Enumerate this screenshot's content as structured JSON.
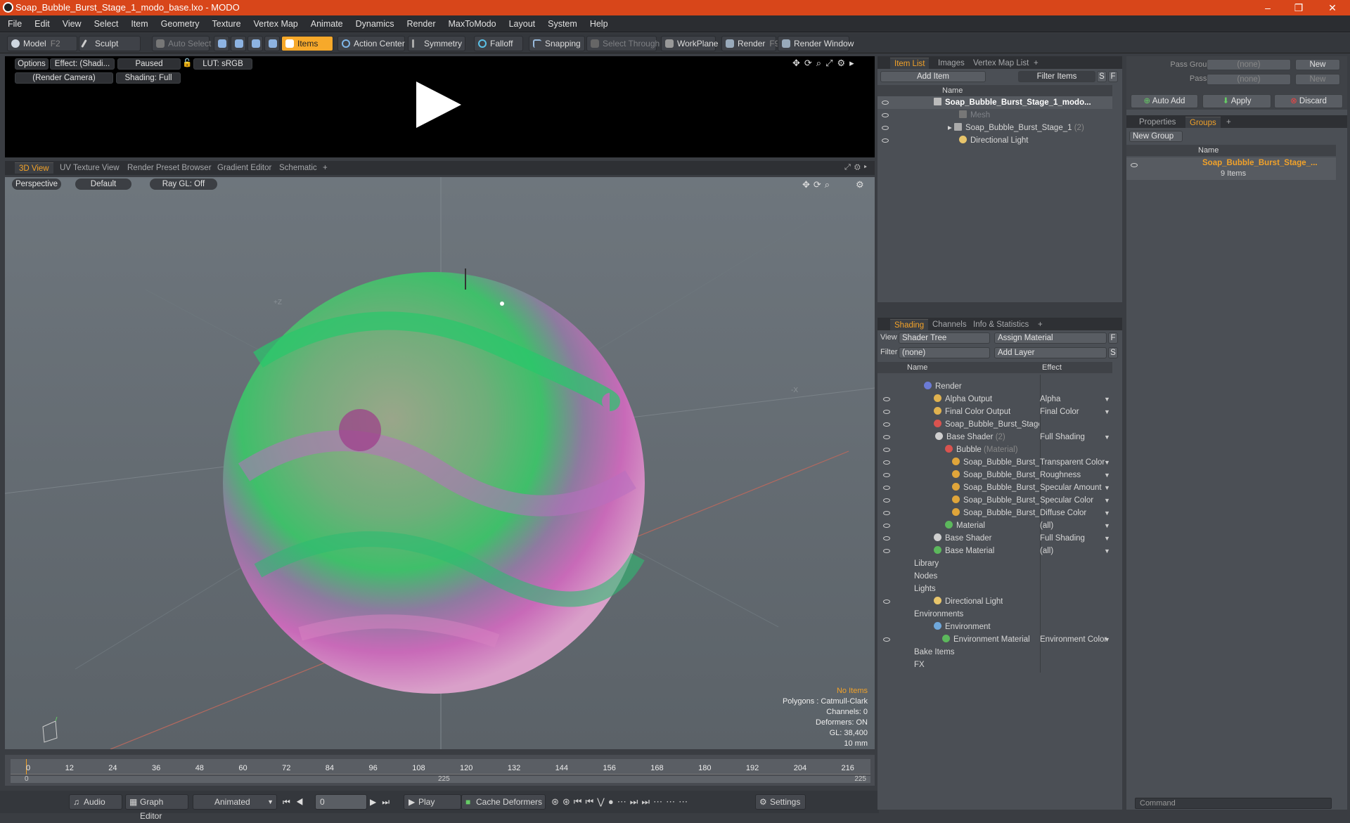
{
  "window": {
    "title": "Soap_Bubble_Burst_Stage_1_modo_base.lxo - MODO",
    "minimize": "–",
    "maximize": "❐",
    "close": "✕"
  },
  "menu": [
    "File",
    "Edit",
    "View",
    "Select",
    "Item",
    "Geometry",
    "Texture",
    "Vertex Map",
    "Animate",
    "Dynamics",
    "Render",
    "MaxToModo",
    "Layout",
    "System",
    "Help"
  ],
  "toolbar": {
    "model": "Model",
    "model_key": "F2",
    "sculpt": "Sculpt",
    "auto_select": "Auto Select",
    "items": "Items",
    "action_center": "Action Center",
    "symmetry": "Symmetry",
    "falloff": "Falloff",
    "snapping": "Snapping",
    "select_through": "Select Through",
    "workplane": "WorkPlane",
    "render": "Render",
    "render_key": "F9",
    "render_window": "Render Window"
  },
  "render_preview": {
    "options": "Options",
    "effect": "Effect: (Shadi...",
    "paused": "Paused",
    "lut": "LUT: sRGB",
    "camera": "(Render Camera)",
    "shading": "Shading: Full"
  },
  "viewport_tabs": [
    "3D View",
    "UV Texture View",
    "Render Preset Browser",
    "Gradient Editor",
    "Schematic",
    "+"
  ],
  "viewport": {
    "projection": "Perspective",
    "style": "Default",
    "raygl": "Ray GL: Off",
    "info_no_items": "No Items",
    "info_lines": [
      "Polygons : Catmull-Clark",
      "Channels: 0",
      "Deformers: ON",
      "GL: 38,400",
      "10 mm"
    ],
    "axis_z": "+Z",
    "axis_x": "-X"
  },
  "timeline": {
    "ticks": [
      "0",
      "12",
      "24",
      "36",
      "48",
      "60",
      "72",
      "84",
      "96",
      "108",
      "120",
      "132",
      "144",
      "156",
      "168",
      "180",
      "192",
      "204",
      "216"
    ],
    "range_start": "0",
    "range_mid": "225",
    "range_end": "225"
  },
  "bottom": {
    "audio": "Audio",
    "graph_editor": "Graph Editor",
    "animated": "Animated",
    "frame": "0",
    "play": "Play",
    "cache_deformers": "Cache Deformers",
    "settings": "Settings"
  },
  "item_list": {
    "tabs": [
      "Item List",
      "Images",
      "Vertex Map List",
      "+"
    ],
    "add_item": "Add Item",
    "filter_items": "Filter Items",
    "s": "S",
    "f": "F",
    "col_name": "Name",
    "rows": [
      {
        "label": "Soap_Bubble_Burst_Stage_1_modo...",
        "count": ""
      },
      {
        "label": "Mesh",
        "count": ""
      },
      {
        "label": "Soap_Bubble_Burst_Stage_1",
        "count": "(2)"
      },
      {
        "label": "Directional Light",
        "count": ""
      }
    ]
  },
  "shading": {
    "tabs": [
      "Shading",
      "Channels",
      "Info & Statistics",
      "+"
    ],
    "view_label": "View",
    "view_value": "Shader Tree",
    "assign_material": "Assign Material",
    "f": "F",
    "filter_label": "Filter",
    "filter_value": "(none)",
    "add_layer": "Add Layer",
    "s": "S",
    "col_name": "Name",
    "col_effect": "Effect",
    "rows": [
      {
        "label": "Render",
        "sub": "",
        "effect": ""
      },
      {
        "label": "Alpha Output",
        "sub": "",
        "effect": "Alpha"
      },
      {
        "label": "Final Color Output",
        "sub": "",
        "effect": "Final Color"
      },
      {
        "label": "Soap_Bubble_Burst_Stage_...",
        "sub": "",
        "effect": ""
      },
      {
        "label": "Base Shader",
        "sub": "(2)",
        "effect": "Full Shading"
      },
      {
        "label": "Bubble",
        "sub": "(Material)",
        "effect": ""
      },
      {
        "label": "Soap_Bubble_Burst_St...",
        "sub": "",
        "effect": "Transparent Color"
      },
      {
        "label": "Soap_Bubble_Burst_St...",
        "sub": "",
        "effect": "Roughness"
      },
      {
        "label": "Soap_Bubble_Burst_St...",
        "sub": "",
        "effect": "Specular Amount"
      },
      {
        "label": "Soap_Bubble_Burst_St...",
        "sub": "",
        "effect": "Specular Color"
      },
      {
        "label": "Soap_Bubble_Burst_St...",
        "sub": "",
        "effect": "Diffuse Color"
      },
      {
        "label": "Material",
        "sub": "",
        "effect": "(all)"
      },
      {
        "label": "Base Shader",
        "sub": "",
        "effect": "Full Shading"
      },
      {
        "label": "Base Material",
        "sub": "",
        "effect": "(all)"
      },
      {
        "label": "Library",
        "sub": "",
        "effect": ""
      },
      {
        "label": "Nodes",
        "sub": "",
        "effect": ""
      },
      {
        "label": "Lights",
        "sub": "",
        "effect": ""
      },
      {
        "label": "Directional Light",
        "sub": "",
        "effect": ""
      },
      {
        "label": "Environments",
        "sub": "",
        "effect": ""
      },
      {
        "label": "Environment",
        "sub": "",
        "effect": ""
      },
      {
        "label": "Environment Material",
        "sub": "",
        "effect": "Environment Color"
      },
      {
        "label": "Bake Items",
        "sub": "",
        "effect": ""
      },
      {
        "label": "FX",
        "sub": "",
        "effect": ""
      }
    ]
  },
  "groups": {
    "pass_groups_label": "Pass Groups",
    "pass_groups_value": "(none)",
    "new": "New",
    "passes_label": "Passes",
    "passes_value": "(none)",
    "new2": "New",
    "auto_add": "Auto Add",
    "apply": "Apply",
    "discard": "Discard",
    "tabs": [
      "Properties",
      "Groups",
      "+"
    ],
    "new_group": "New Group",
    "col_name": "Name",
    "group_name": "Soap_Bubble_Burst_Stage_...",
    "group_count": "9 Items",
    "command_placeholder": "Command"
  }
}
